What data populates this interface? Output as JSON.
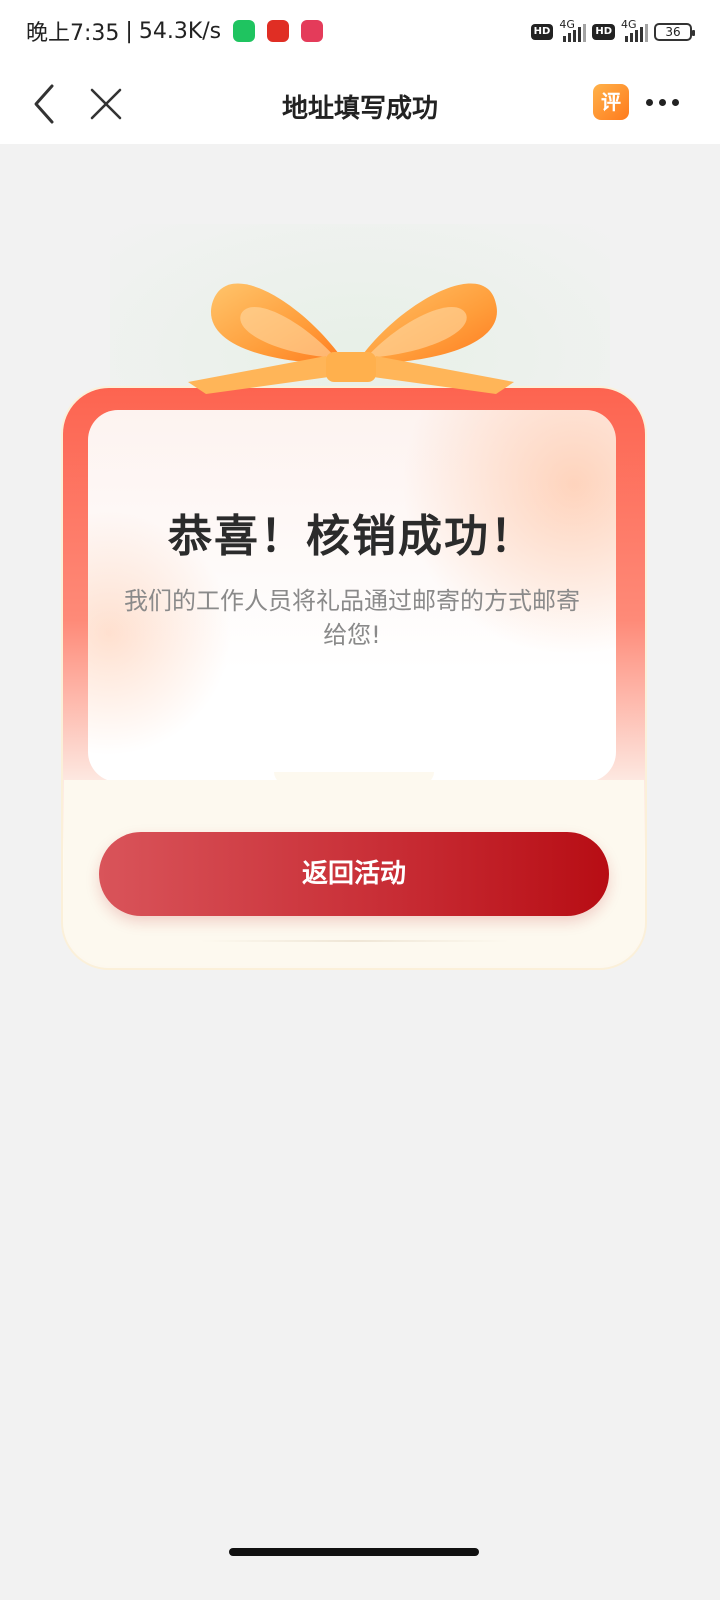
{
  "status_bar": {
    "time": "晚上7:35",
    "separator": "|",
    "speed": "54.3K/s",
    "app_icons": [
      "wechat-icon",
      "pinduoduo-icon",
      "mall-icon"
    ],
    "network_1": "4G",
    "network_2": "4G",
    "hd_label": "HD",
    "battery": "36"
  },
  "nav": {
    "title": "地址填写成功",
    "review_badge": "评"
  },
  "card": {
    "title": "恭喜！核销成功！",
    "description": "我们的工作人员将礼品通过邮寄的方式邮寄给您!",
    "button_label": "返回活动"
  },
  "colors": {
    "button_start": "#d9545a",
    "button_end": "#b70d14",
    "card_frame": "#fd6450",
    "bow": "#ff9d3a",
    "background": "#f2f2f2"
  }
}
